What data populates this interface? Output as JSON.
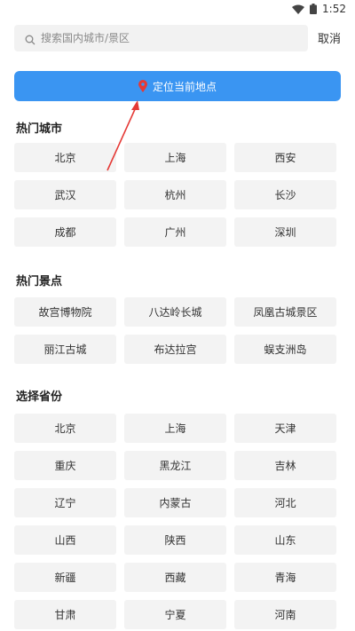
{
  "status_bar": {
    "time": "1:52"
  },
  "search": {
    "placeholder": "搜索国内城市/景区",
    "cancel_label": "取消"
  },
  "locate": {
    "label": "定位当前地点"
  },
  "hot_cities": {
    "title": "热门城市",
    "items": [
      "北京",
      "上海",
      "西安",
      "武汉",
      "杭州",
      "长沙",
      "成都",
      "广州",
      "深圳"
    ]
  },
  "hot_spots": {
    "title": "热门景点",
    "items": [
      "故宫博物院",
      "八达岭长城",
      "凤凰古城景区",
      "丽江古城",
      "布达拉宫",
      "蜈支洲岛"
    ]
  },
  "provinces": {
    "title": "选择省份",
    "items": [
      "北京",
      "上海",
      "天津",
      "重庆",
      "黑龙江",
      "吉林",
      "辽宁",
      "内蒙古",
      "河北",
      "山西",
      "陕西",
      "山东",
      "新疆",
      "西藏",
      "青海",
      "甘肃",
      "宁夏",
      "河南"
    ]
  },
  "colors": {
    "accent": "#3a95f2",
    "pin": "#e53935",
    "annotation": "#e53935",
    "cell_bg": "#f3f3f3"
  }
}
